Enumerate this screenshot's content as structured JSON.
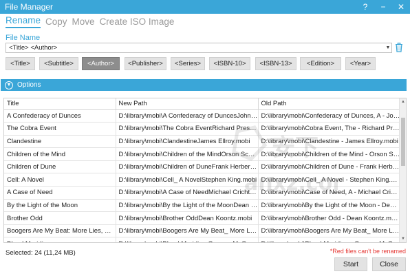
{
  "window": {
    "title": "File Manager",
    "help_icon": "?",
    "minimize_icon": "−",
    "close_icon": "✕"
  },
  "tabs": [
    {
      "label": "Rename",
      "active": true
    },
    {
      "label": "Copy",
      "active": false
    },
    {
      "label": "Move",
      "active": false
    },
    {
      "label": "Create ISO Image",
      "active": false
    }
  ],
  "file_name": {
    "label": "File Name",
    "value": "<Title> <Author>"
  },
  "tags": [
    {
      "label": "<Title>",
      "active": false
    },
    {
      "label": "<Subtitle>",
      "active": false
    },
    {
      "label": "<Author>",
      "active": true
    },
    {
      "label": "<Publisher>",
      "active": false
    },
    {
      "label": "<Series>",
      "active": false
    },
    {
      "label": "<ISBN-10>",
      "active": false
    },
    {
      "label": "<ISBN-13>",
      "active": false
    },
    {
      "label": "<Edition>",
      "active": false
    },
    {
      "label": "<Year>",
      "active": false
    }
  ],
  "options": {
    "label": "Options",
    "icon": "chevron-down-circle-icon"
  },
  "table": {
    "headers": [
      "Title",
      "New Path",
      "Old Path"
    ],
    "rows": [
      [
        "A Confederacy of Dunces",
        "D:\\library\\mobi\\A Confederacy of DuncesJohn Kenned...",
        "D:\\library\\mobi\\Confederacy of Dunces, A - John Kenn..."
      ],
      [
        "The Cobra Event",
        "D:\\library\\mobi\\The Cobra EventRichard Preston.mobi",
        "D:\\library\\mobi\\Cobra Event, The - Richard Preston.mobi"
      ],
      [
        "Clandestine",
        "D:\\library\\mobi\\ClandestineJames Ellroy.mobi",
        "D:\\library\\mobi\\Clandestine - James Ellroy.mobi"
      ],
      [
        "Children of the Mind",
        "D:\\library\\mobi\\Children of the MindOrson Scott Car...",
        "D:\\library\\mobi\\Children of the Mind - Orson Scott Car..."
      ],
      [
        "Children of Dune",
        "D:\\library\\mobi\\Children of DuneFrank Herbert.mobi",
        "D:\\library\\mobi\\Children of Dune - Frank Herbert.mobi"
      ],
      [
        "Cell: A Novel",
        "D:\\library\\mobi\\Cell_ A NovelStephen King.mobi",
        "D:\\library\\mobi\\Cell_ A Novel - Stephen King.mobi"
      ],
      [
        "A Case of Need",
        "D:\\library\\mobi\\A Case of NeedMichael Crichton.mobi",
        "D:\\library\\mobi\\Case of Need, A - Michael Crichton.mo..."
      ],
      [
        "By the Light of the Moon",
        "D:\\library\\mobi\\By the Light of the MoonDean Koontz...",
        "D:\\library\\mobi\\By the Light of the Moon - Dean Koont..."
      ],
      [
        "Brother Odd",
        "D:\\library\\mobi\\Brother OddDean Koontz.mobi",
        "D:\\library\\mobi\\Brother Odd - Dean Koontz.mobi"
      ],
      [
        "Boogers Are My Beat: More Lies, But Some...",
        "D:\\library\\mobi\\Boogers Are My Beat_ More Lies, But S...",
        "D:\\library\\mobi\\Boogers Are My Beat_ More Lies, But S..."
      ],
      [
        "Blood Meridian",
        "D:\\library\\mobi\\Blood Meridian Cormac McCarthy.mobi",
        "D:\\library\\mobi\\Blood Meridian - Cormac McCarthy.mobi"
      ]
    ]
  },
  "status": {
    "selected_text": "Selected:  24 (11,24 MB)",
    "red_note": "*Red files can't be renamed"
  },
  "buttons": {
    "start": "Start",
    "close": "Close"
  },
  "watermark": {
    "text": "anxz.com"
  },
  "colors": {
    "accent": "#3aa6d8",
    "active_tag": "#8d8d8d",
    "red": "#e53935"
  }
}
